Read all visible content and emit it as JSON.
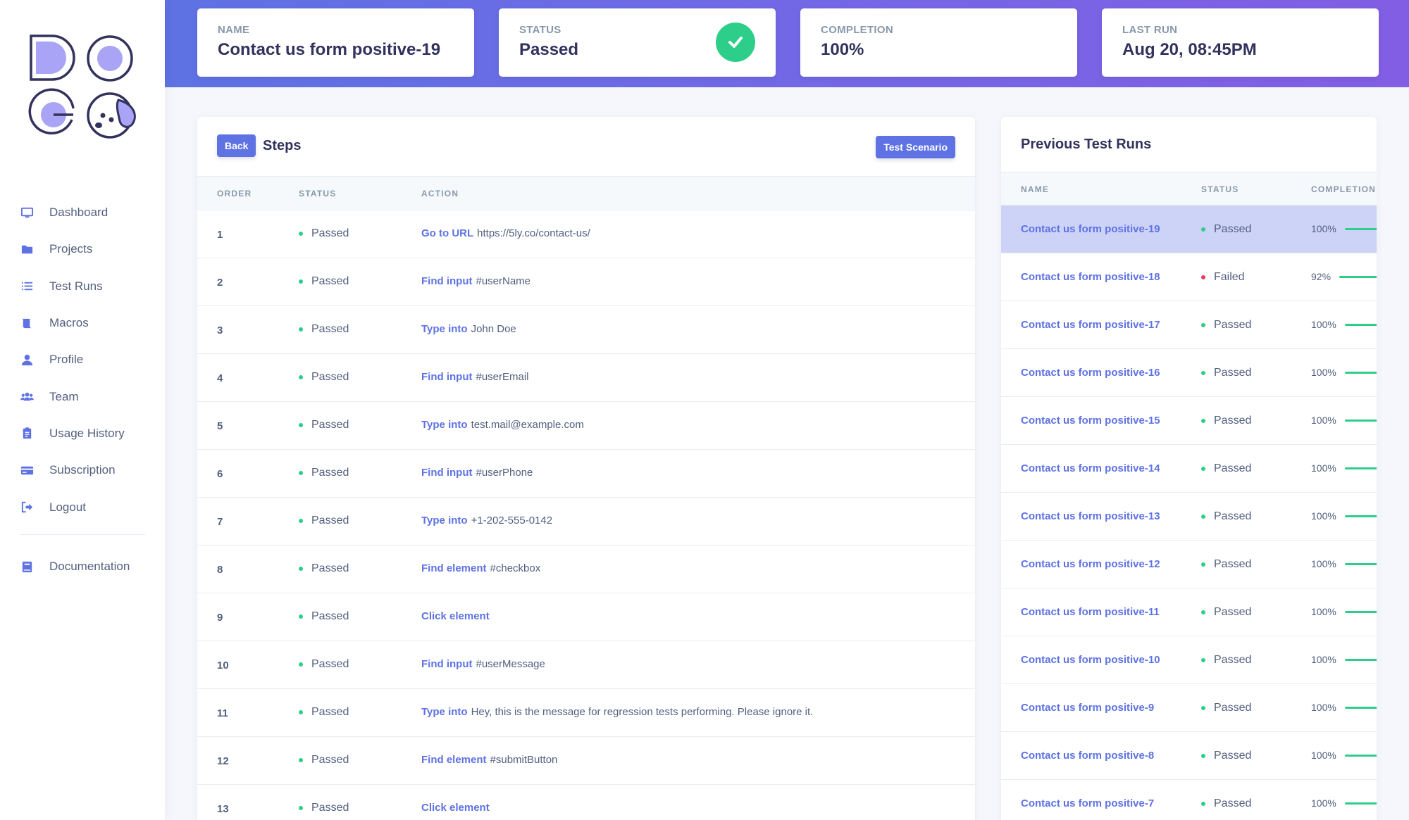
{
  "sidebar": {
    "items": [
      {
        "label": "Dashboard",
        "icon": "monitor-icon"
      },
      {
        "label": "Projects",
        "icon": "folder-icon"
      },
      {
        "label": "Test Runs",
        "icon": "list-icon"
      },
      {
        "label": "Macros",
        "icon": "scroll-icon"
      },
      {
        "label": "Profile",
        "icon": "user-icon"
      },
      {
        "label": "Team",
        "icon": "team-icon"
      },
      {
        "label": "Usage History",
        "icon": "clipboard-icon"
      },
      {
        "label": "Subscription",
        "icon": "credit-card-icon"
      },
      {
        "label": "Logout",
        "icon": "logout-icon"
      }
    ],
    "documentation": {
      "label": "Documentation",
      "icon": "book-icon"
    }
  },
  "stats": {
    "name": {
      "label": "NAME",
      "value": "Contact us form positive-19"
    },
    "status": {
      "label": "STATUS",
      "value": "Passed"
    },
    "completion": {
      "label": "COMPLETION",
      "value": "100%"
    },
    "last_run": {
      "label": "LAST RUN",
      "value": "Aug 20, 08:45PM"
    }
  },
  "steps": {
    "back_label": "Back",
    "title": "Steps",
    "scenario_label": "Test Scenario",
    "columns": {
      "order": "ORDER",
      "status": "STATUS",
      "action": "ACTION"
    },
    "rows": [
      {
        "order": "1",
        "status": "Passed",
        "verb": "Go to URL",
        "target": "https://5ly.co/contact-us/"
      },
      {
        "order": "2",
        "status": "Passed",
        "verb": "Find input",
        "target": "#userName"
      },
      {
        "order": "3",
        "status": "Passed",
        "verb": "Type into",
        "target": "John Doe"
      },
      {
        "order": "4",
        "status": "Passed",
        "verb": "Find input",
        "target": "#userEmail"
      },
      {
        "order": "5",
        "status": "Passed",
        "verb": "Type into",
        "target": "test.mail@example.com"
      },
      {
        "order": "6",
        "status": "Passed",
        "verb": "Find input",
        "target": "#userPhone"
      },
      {
        "order": "7",
        "status": "Passed",
        "verb": "Type into",
        "target": "+1-202-555-0142"
      },
      {
        "order": "8",
        "status": "Passed",
        "verb": "Find element",
        "target": "#checkbox"
      },
      {
        "order": "9",
        "status": "Passed",
        "verb": "Click element",
        "target": ""
      },
      {
        "order": "10",
        "status": "Passed",
        "verb": "Find input",
        "target": "#userMessage"
      },
      {
        "order": "11",
        "status": "Passed",
        "verb": "Type into",
        "target": "Hey, this is the message for regression tests performing. Please ignore it."
      },
      {
        "order": "12",
        "status": "Passed",
        "verb": "Find element",
        "target": "#submitButton"
      },
      {
        "order": "13",
        "status": "Passed",
        "verb": "Click element",
        "target": ""
      }
    ]
  },
  "runs": {
    "title": "Previous Test Runs",
    "columns": {
      "name": "NAME",
      "status": "STATUS",
      "completion": "COMPLETION"
    },
    "rows": [
      {
        "name": "Contact us form positive-19",
        "status": "Passed",
        "completion": "100%",
        "active": true
      },
      {
        "name": "Contact us form positive-18",
        "status": "Failed",
        "completion": "92%"
      },
      {
        "name": "Contact us form positive-17",
        "status": "Passed",
        "completion": "100%"
      },
      {
        "name": "Contact us form positive-16",
        "status": "Passed",
        "completion": "100%"
      },
      {
        "name": "Contact us form positive-15",
        "status": "Passed",
        "completion": "100%"
      },
      {
        "name": "Contact us form positive-14",
        "status": "Passed",
        "completion": "100%"
      },
      {
        "name": "Contact us form positive-13",
        "status": "Passed",
        "completion": "100%"
      },
      {
        "name": "Contact us form positive-12",
        "status": "Passed",
        "completion": "100%"
      },
      {
        "name": "Contact us form positive-11",
        "status": "Passed",
        "completion": "100%"
      },
      {
        "name": "Contact us form positive-10",
        "status": "Passed",
        "completion": "100%"
      },
      {
        "name": "Contact us form positive-9",
        "status": "Passed",
        "completion": "100%"
      },
      {
        "name": "Contact us form positive-8",
        "status": "Passed",
        "completion": "100%"
      },
      {
        "name": "Contact us form positive-7",
        "status": "Passed",
        "completion": "100%"
      }
    ]
  },
  "colors": {
    "accent": "#5e72e4",
    "success": "#2dce89",
    "danger": "#f5365c"
  }
}
